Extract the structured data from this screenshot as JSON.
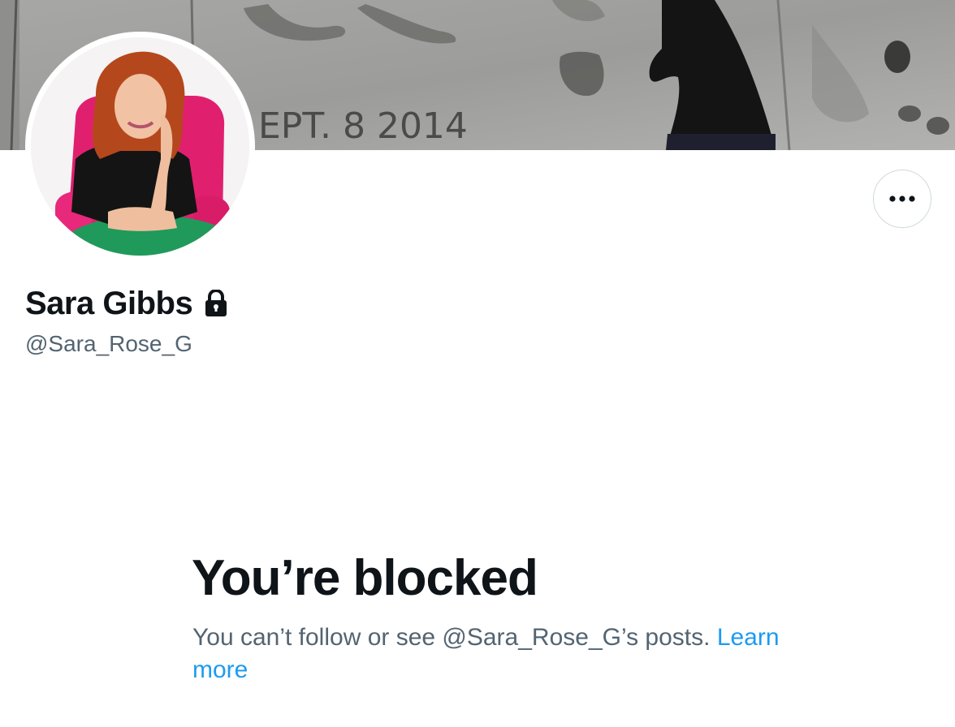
{
  "profile": {
    "display_name": "Sara Gibbs",
    "handle": "@Sara_Rose_G",
    "protected": true
  },
  "banner": {
    "engraved_text": "EPT. 8 2014"
  },
  "icons": {
    "lock": "lock-icon",
    "more": "more-horizontal-icon"
  },
  "blocked": {
    "title": "You’re blocked",
    "message": "You can’t follow or see @Sara_Rose_G’s posts. ",
    "link_label": "Learn more"
  },
  "colors": {
    "text_primary": "#0f1419",
    "text_secondary": "#536471",
    "link": "#1d9bf0",
    "border": "#cfd9de"
  }
}
